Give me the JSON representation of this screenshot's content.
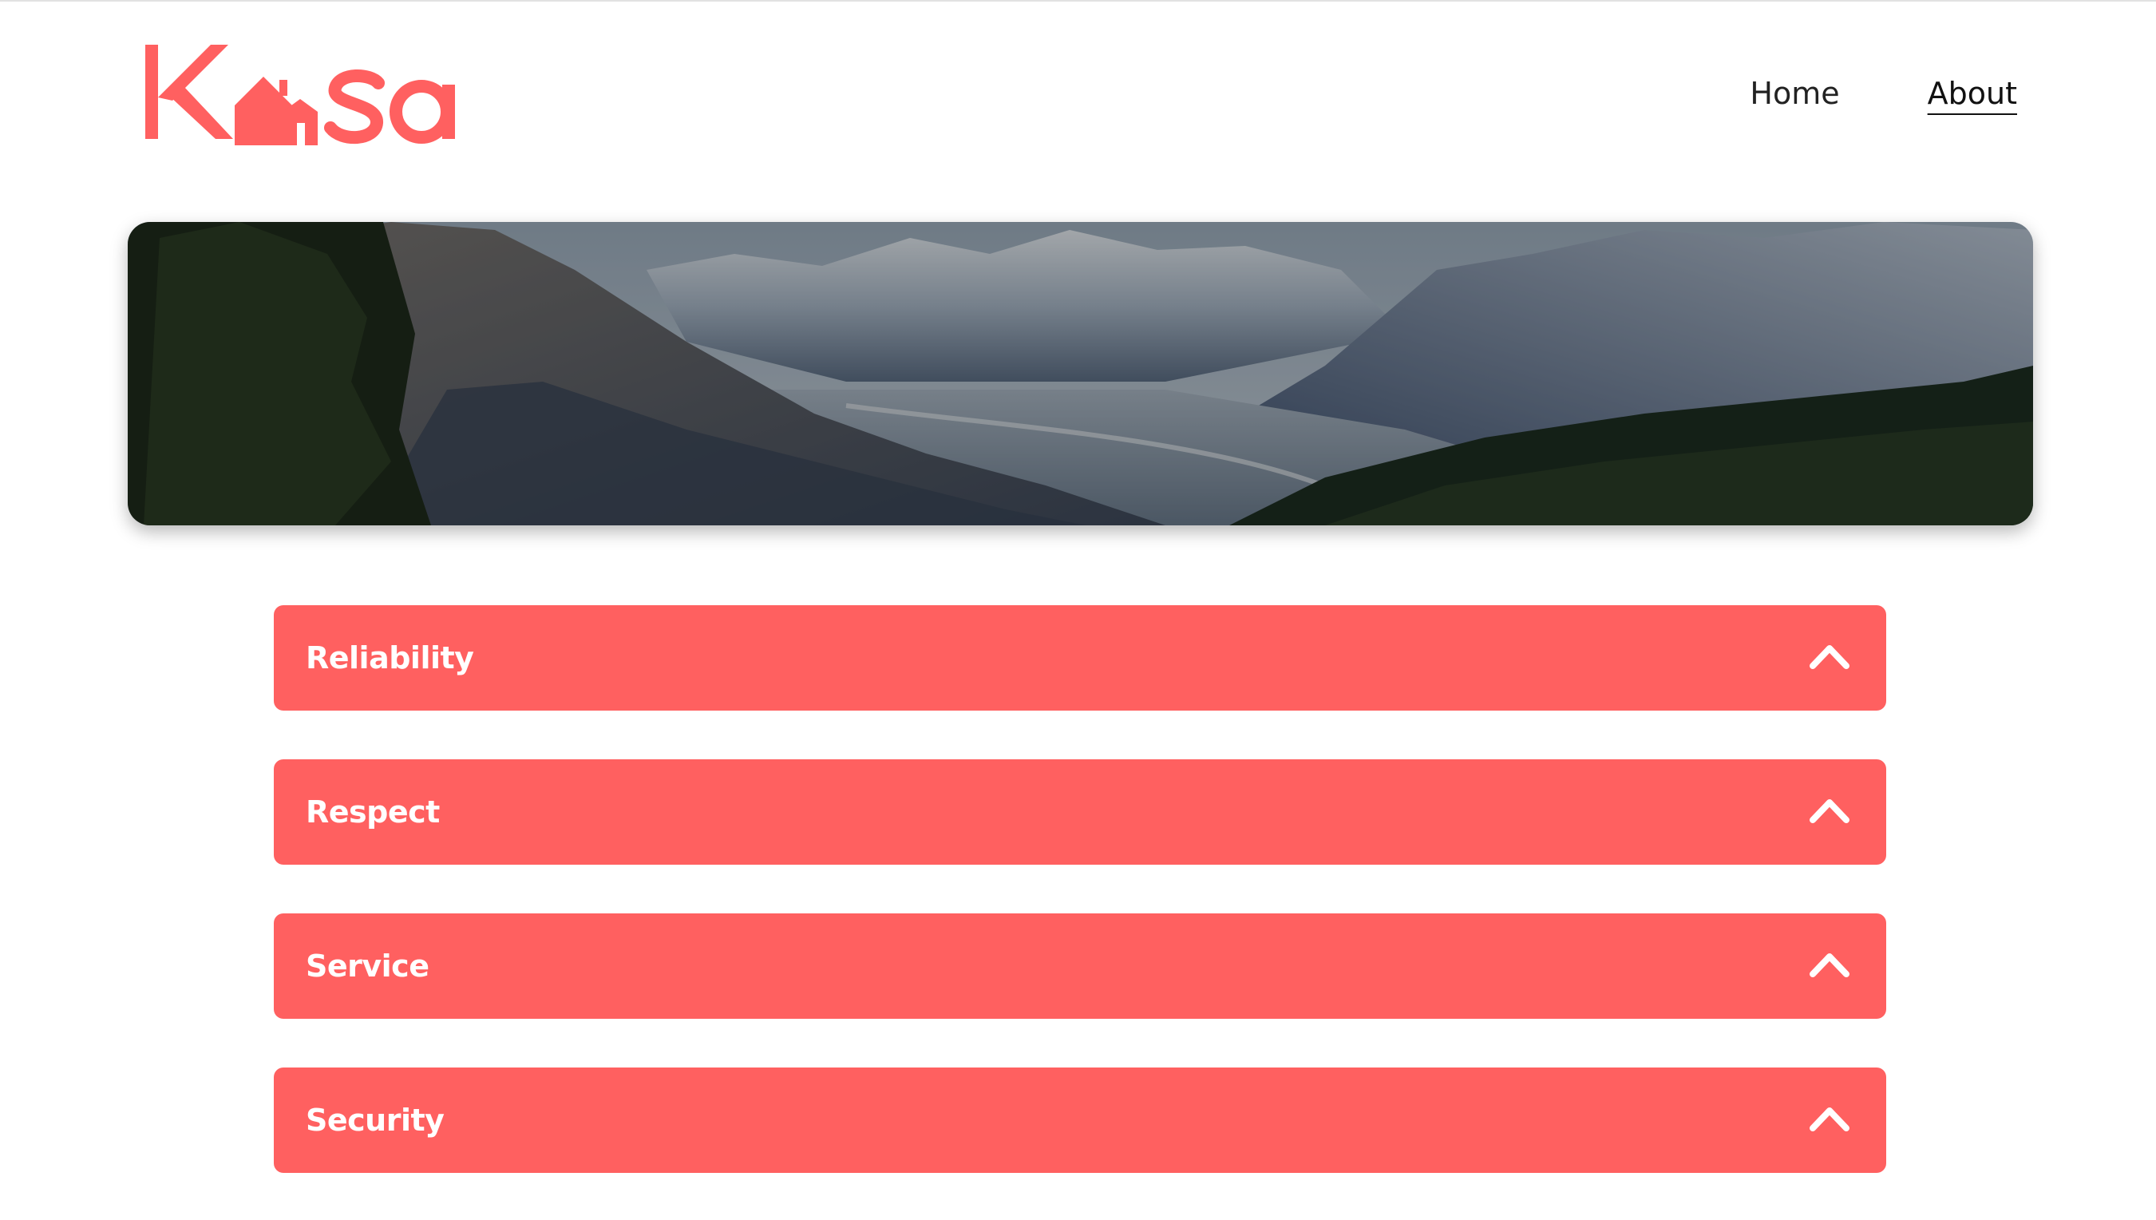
{
  "brand": {
    "name": "Kasa",
    "color": "#ff6060"
  },
  "nav": {
    "items": [
      {
        "label": "Home",
        "active": false
      },
      {
        "label": "About",
        "active": true
      }
    ]
  },
  "banner": {
    "image": "mountain-valley-landscape"
  },
  "collapses": [
    {
      "title": "Reliability",
      "icon": "chevron-up-icon"
    },
    {
      "title": "Respect",
      "icon": "chevron-up-icon"
    },
    {
      "title": "Service",
      "icon": "chevron-up-icon"
    },
    {
      "title": "Security",
      "icon": "chevron-up-icon"
    }
  ]
}
